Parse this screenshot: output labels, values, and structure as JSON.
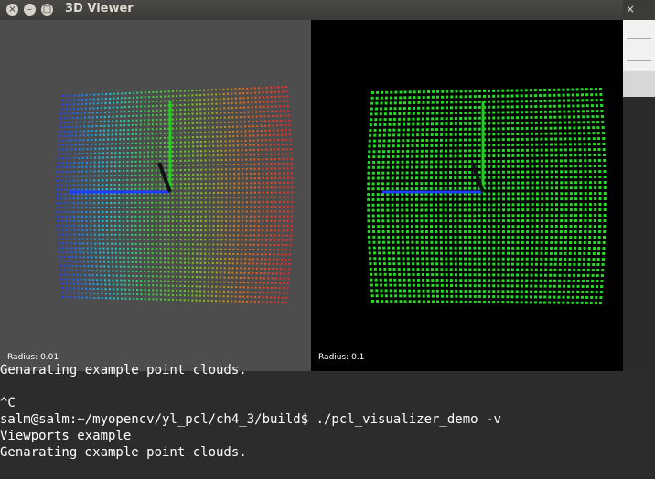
{
  "window": {
    "title": "3D Viewer",
    "controls": {
      "close": "×",
      "minimize": "–",
      "maximize": "□"
    }
  },
  "viewports": [
    {
      "label": "Radius: 0.01",
      "background": "#4d4d4d",
      "coloring": "rainbow"
    },
    {
      "label": "Radius: 0.1",
      "background": "#000000",
      "coloring": "green"
    }
  ],
  "terminal": {
    "lines": [
      "Genarating example point clouds.",
      "",
      "^C",
      "salm@salm:~/myopencv/yl_pcl/ch4_3/build$ ./pcl_visualizer_demo -v",
      "Viewports example",
      "Genarating example point clouds."
    ]
  },
  "colors": {
    "accent_close": "#e95420",
    "point_green": "#22dd22",
    "axis_blue": "#1e3cff"
  }
}
